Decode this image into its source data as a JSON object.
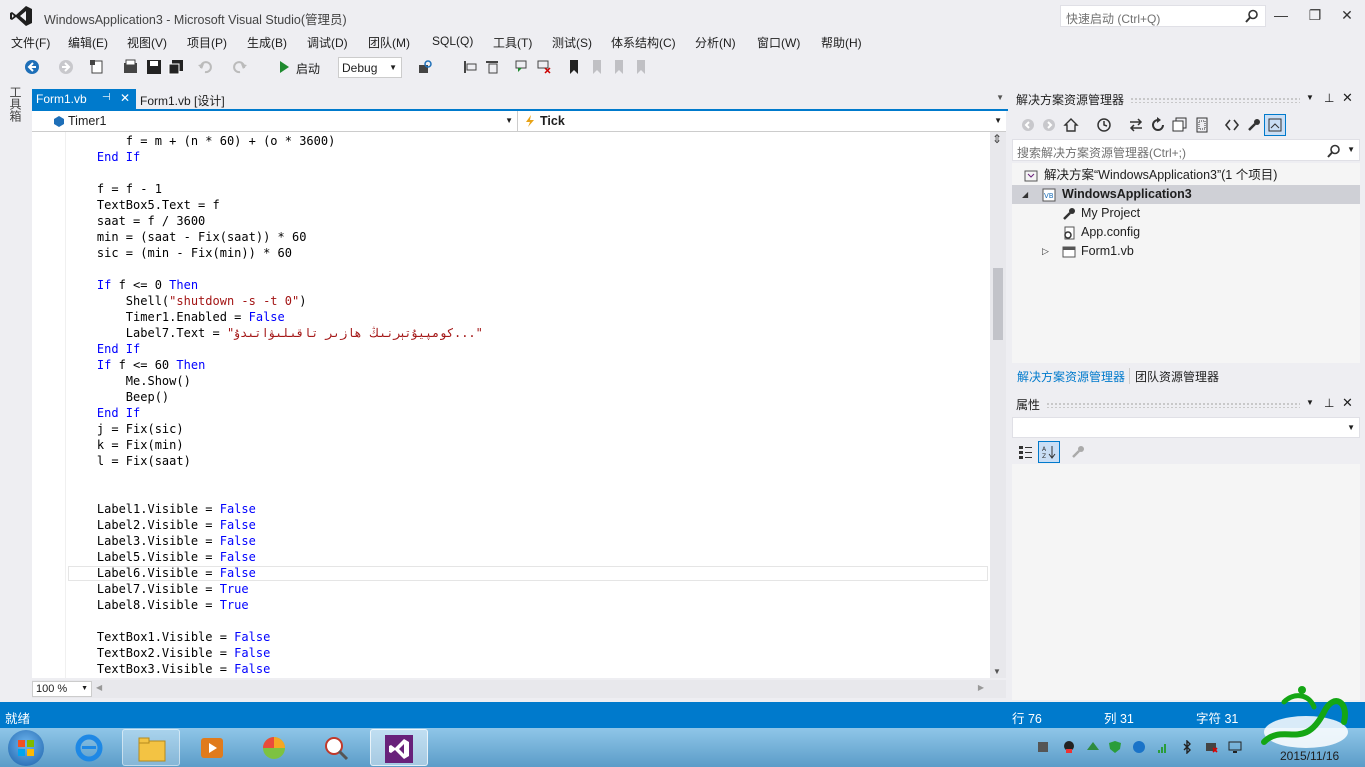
{
  "window": {
    "title": "WindowsApplication3 - Microsoft Visual Studio(管理员)",
    "quick_launch_placeholder": "快速启动 (Ctrl+Q)",
    "min": "—",
    "max": "❐",
    "close": "✕"
  },
  "menu": [
    "文件(F)",
    "编辑(E)",
    "视图(V)",
    "项目(P)",
    "生成(B)",
    "调试(D)",
    "团队(M)",
    "SQL(Q)",
    "工具(T)",
    "测试(S)",
    "体系结构(C)",
    "分析(N)",
    "窗口(W)",
    "帮助(H)"
  ],
  "toolbar": {
    "start_label": "启动",
    "config": "Debug"
  },
  "toolbox_label": "工具箱",
  "editor": {
    "tabs": [
      {
        "label": "Form1.vb",
        "pin": "⊣",
        "close": "✕"
      },
      {
        "label": "Form1.vb [设计]"
      }
    ],
    "object_combo": "Timer1",
    "event_combo": "Tick",
    "zoom": "100 %",
    "lines": [
      [
        {
          "t": "        f = m + (n * 60) + (o * 3600)"
        }
      ],
      [
        {
          "t": "    "
        },
        {
          "t": "End If",
          "k": 1
        }
      ],
      [
        {
          "t": ""
        }
      ],
      [
        {
          "t": "    f = f - 1"
        }
      ],
      [
        {
          "t": "    TextBox5.Text = f"
        }
      ],
      [
        {
          "t": "    saat = f / 3600"
        }
      ],
      [
        {
          "t": "    min = (saat - Fix(saat)) * 60"
        }
      ],
      [
        {
          "t": "    sic = (min - Fix(min)) * 60"
        }
      ],
      [
        {
          "t": ""
        }
      ],
      [
        {
          "t": "    "
        },
        {
          "t": "If",
          "k": 1
        },
        {
          "t": " f <= 0 "
        },
        {
          "t": "Then",
          "k": 1
        }
      ],
      [
        {
          "t": "        Shell("
        },
        {
          "t": "\"shutdown -s -t 0\"",
          "s": 1
        },
        {
          "t": ")"
        }
      ],
      [
        {
          "t": "        Timer1.Enabled = "
        },
        {
          "t": "False",
          "k": 1
        }
      ],
      [
        {
          "t": "        Label7.Text = "
        },
        {
          "t": "\"كومپيۇتېرنىڭ ھازىر تاقىلىۋاتىدۇ...\"",
          "s": 1
        }
      ],
      [
        {
          "t": "    "
        },
        {
          "t": "End If",
          "k": 1
        }
      ],
      [
        {
          "t": "    "
        },
        {
          "t": "If",
          "k": 1
        },
        {
          "t": " f <= 60 "
        },
        {
          "t": "Then",
          "k": 1
        }
      ],
      [
        {
          "t": "        Me.Show()"
        }
      ],
      [
        {
          "t": "        Beep()"
        }
      ],
      [
        {
          "t": "    "
        },
        {
          "t": "End If",
          "k": 1
        }
      ],
      [
        {
          "t": "    j = Fix(sic)"
        }
      ],
      [
        {
          "t": "    k = Fix(min)"
        }
      ],
      [
        {
          "t": "    l = Fix(saat)"
        }
      ],
      [
        {
          "t": ""
        }
      ],
      [
        {
          "t": ""
        }
      ],
      [
        {
          "t": "    Label1.Visible = "
        },
        {
          "t": "False",
          "k": 1
        }
      ],
      [
        {
          "t": "    Label2.Visible = "
        },
        {
          "t": "False",
          "k": 1
        }
      ],
      [
        {
          "t": "    Label3.Visible = "
        },
        {
          "t": "False",
          "k": 1
        }
      ],
      [
        {
          "t": "    Label5.Visible = "
        },
        {
          "t": "False",
          "k": 1
        }
      ],
      [
        {
          "t": "    Label6.Visible = "
        },
        {
          "t": "False",
          "k": 1
        }
      ],
      [
        {
          "t": "    Label7.Visible = "
        },
        {
          "t": "True",
          "k": 1
        }
      ],
      [
        {
          "t": "    Label8.Visible = "
        },
        {
          "t": "True",
          "k": 1
        }
      ],
      [
        {
          "t": ""
        }
      ],
      [
        {
          "t": "    TextBox1.Visible = "
        },
        {
          "t": "False",
          "k": 1
        }
      ],
      [
        {
          "t": "    TextBox2.Visible = "
        },
        {
          "t": "False",
          "k": 1
        }
      ],
      [
        {
          "t": "    TextBox3.Visible = "
        },
        {
          "t": "False",
          "k": 1
        }
      ]
    ]
  },
  "solution_explorer": {
    "title": "解决方案资源管理器",
    "search_placeholder": "搜索解决方案资源管理器(Ctrl+;)",
    "tree": {
      "solution": "解决方案“WindowsApplication3”(1 个项目)",
      "project": "WindowsApplication3",
      "items": [
        "My Project",
        "App.config",
        "Form1.vb"
      ]
    },
    "tabs": [
      "解决方案资源管理器",
      "团队资源管理器"
    ]
  },
  "properties": {
    "title": "属性"
  },
  "statusbar": {
    "ready": "就绪",
    "line": "行 76",
    "col": "列 31",
    "char": "字符 31"
  },
  "taskbar": {
    "clock": "2015/11/16"
  },
  "colors": {
    "accent": "#007acc",
    "keyword": "#0000ff",
    "string": "#a31515"
  }
}
